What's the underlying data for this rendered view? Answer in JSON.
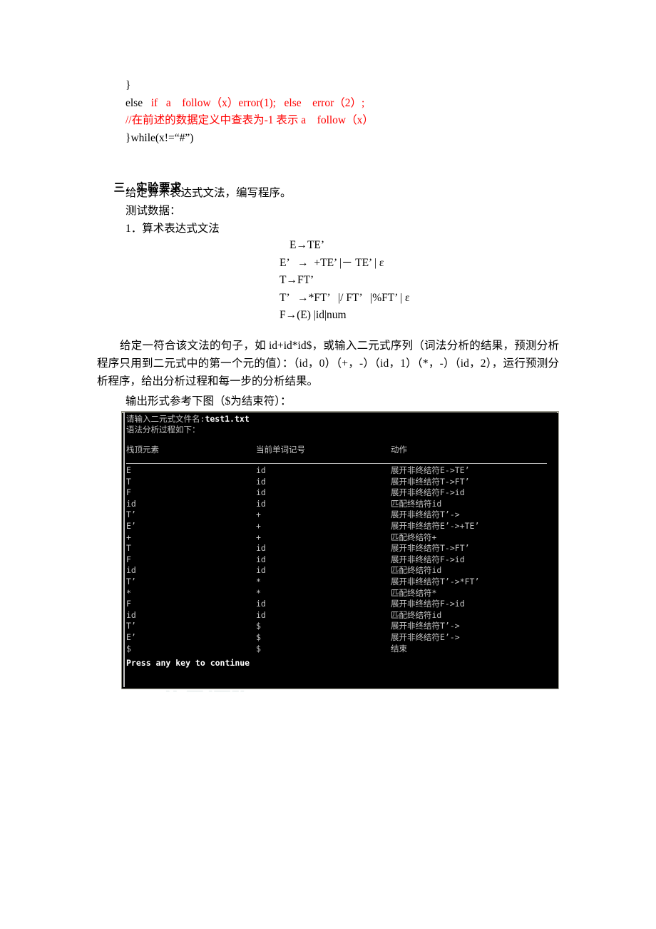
{
  "code_block": {
    "lines": [
      {
        "segments": [
          {
            "text": "}",
            "color": "black"
          }
        ]
      },
      {
        "segments": [
          {
            "text": "else   ",
            "color": "black"
          },
          {
            "text": "if   a    follow（x）error(1);   else    error（2）;",
            "color": "red"
          }
        ]
      },
      {
        "segments": [
          {
            "text": "//在前述的数据定义中查表为-1 表示 a    follow（x）",
            "color": "red"
          }
        ]
      },
      {
        "segments": [
          {
            "text": "}while(x!=“#”)",
            "color": "black"
          }
        ]
      }
    ]
  },
  "section": {
    "number": "三.",
    "title": "实验要求",
    "lines": [
      "给定算术表达式文法，编写程序。",
      "测试数据：",
      "1．算术表达式文法"
    ]
  },
  "grammar": {
    "productions": [
      {
        "text": "E→TE’",
        "indent": true
      },
      {
        "text": "E’   →  +TE’ |－ TE’ | ε",
        "indent": false
      },
      {
        "text": "T→FT’",
        "indent": false
      },
      {
        "text": "T’   →*FT’   |/ FT’   |%FT’ | ε",
        "indent": false
      },
      {
        "text": "F→(E) |id|num",
        "indent": false
      }
    ]
  },
  "paragraphs": {
    "p1": "给定一符合该文法的句子，如 id+id*id$，或输入二元式序列（词法分析的结果，预测分析程序只用到二元式中的第一个元的值）：（id，0）（+，-）（id，1）（*，-）（id，2），运行预测分析程序，给出分析过程和每一步的分析结果。",
    "p2": "输出形式参考下图（$为结束符）："
  },
  "terminal": {
    "prompt_label": "请输入二元式文件名:",
    "prompt_value": "test1.txt",
    "subtitle": "语法分析过程如下：",
    "columns": {
      "stack_top": "栈顶元素",
      "current_token": "当前单词记号",
      "action": "动作"
    },
    "footer": "Press any key to continue",
    "rows": [
      {
        "stack": "E",
        "token": "id",
        "action": "展开非终结符E->TE’"
      },
      {
        "stack": "T",
        "token": "id",
        "action": "展开非终结符T->FT’"
      },
      {
        "stack": "F",
        "token": "id",
        "action": "展开非终结符F->id"
      },
      {
        "stack": "id",
        "token": "id",
        "action": "匹配终结符id"
      },
      {
        "stack": "T’",
        "token": "+",
        "action": "展开非终结符T’->"
      },
      {
        "stack": "E’",
        "token": "+",
        "action": "展开非终结符E’->+TE’"
      },
      {
        "stack": "+",
        "token": "+",
        "action": "匹配终结符+"
      },
      {
        "stack": "T",
        "token": "id",
        "action": "展开非终结符T->FT’"
      },
      {
        "stack": "F",
        "token": "id",
        "action": "展开非终结符F->id"
      },
      {
        "stack": "id",
        "token": "id",
        "action": "匹配终结符id"
      },
      {
        "stack": "T’",
        "token": "*",
        "action": "展开非终结符T’->*FT’"
      },
      {
        "stack": "*",
        "token": "*",
        "action": "匹配终结符*"
      },
      {
        "stack": "F",
        "token": "id",
        "action": "展开非终结符F->id"
      },
      {
        "stack": "id",
        "token": "id",
        "action": "匹配终结符id"
      },
      {
        "stack": "T’",
        "token": "$",
        "action": "展开非终结符T’->"
      },
      {
        "stack": "E’",
        "token": "$",
        "action": "展开非终结符E’->"
      },
      {
        "stack": "$",
        "token": "$",
        "action": "结束"
      }
    ]
  },
  "colors": {
    "red_text": "#ff0000",
    "body_text": "#000000",
    "terminal_bg": "#000000",
    "terminal_fg": "#c6c6c6",
    "terminal_border": "#a8a89c"
  }
}
